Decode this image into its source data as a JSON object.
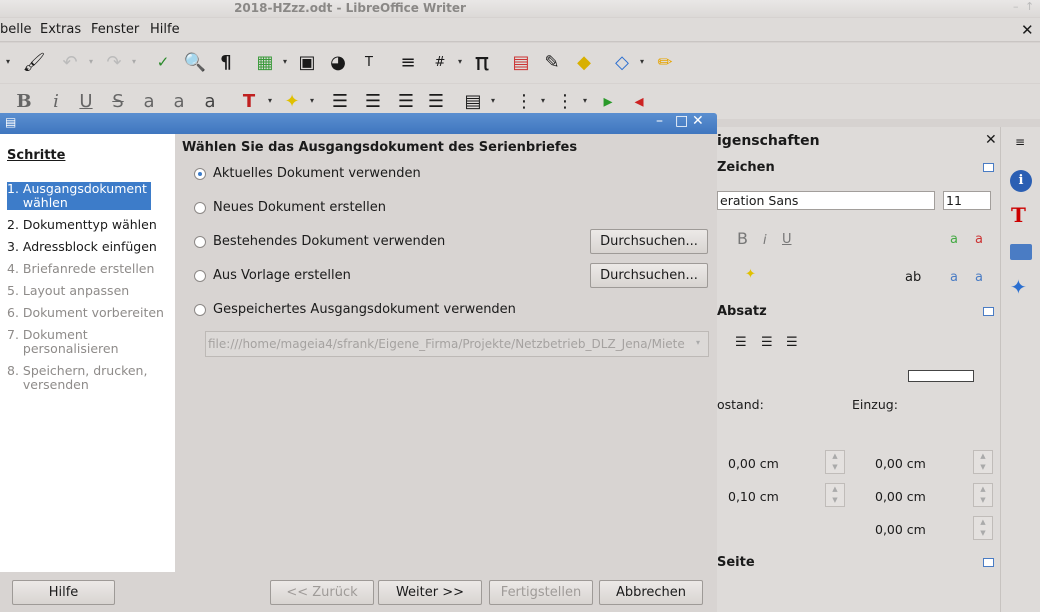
{
  "window": {
    "title": "2018-HZzz.odt - LibreOffice Writer"
  },
  "menubar": {
    "items": [
      "belle",
      "Extras",
      "Fenster",
      "Hilfe"
    ],
    "close": "✕"
  },
  "dialog": {
    "steps_heading": "Schritte",
    "steps": [
      {
        "label": "1. Ausgangsdokument\n    wählen",
        "state": "active"
      },
      {
        "label": "2. Dokumenttyp wählen",
        "state": "enabled"
      },
      {
        "label": "3. Adressblock einfügen",
        "state": "enabled"
      },
      {
        "label": "4. Briefanrede erstellen",
        "state": "disabled"
      },
      {
        "label": "5. Layout anpassen",
        "state": "disabled"
      },
      {
        "label": "6. Dokument vorbereiten",
        "state": "disabled"
      },
      {
        "label": "7. Dokument\n    personalisieren",
        "state": "disabled"
      },
      {
        "label": "8. Speichern, drucken,\n    versenden",
        "state": "disabled"
      }
    ],
    "heading": "Wählen Sie das Ausgangsdokument des Serienbriefes",
    "options": [
      {
        "label": "Aktuelles Dokument verwenden",
        "selected": true
      },
      {
        "label": "Neues Dokument erstellen",
        "selected": false
      },
      {
        "label": "Bestehendes Dokument verwenden",
        "selected": false
      },
      {
        "label": "Aus Vorlage erstellen",
        "selected": false
      },
      {
        "label": "Gespeichertes Ausgangsdokument verwenden",
        "selected": false
      }
    ],
    "browse_label": "Durchsuchen...",
    "saved_path": "file:///home/mageia4/sfrank/Eigene_Firma/Projekte/Netzbetrieb_DLZ_Jena/Miete",
    "buttons": {
      "help": "Hilfe",
      "back": "<< Zurück",
      "next": "Weiter >>",
      "finish": "Fertigstellen",
      "cancel": "Abbrechen"
    }
  },
  "sidebar": {
    "title": "igenschaften",
    "close": "✕",
    "section_zeichen": "Zeichen",
    "font_name": "eration Sans",
    "font_size": "11",
    "section_absatz": "Absatz",
    "abstand_label": "ostand:",
    "einzug_label": "Einzug:",
    "spacing_values": [
      "0,00 cm",
      "0,10 cm"
    ],
    "indent_values": [
      "0,00 cm",
      "0,00 cm",
      "0,00 cm"
    ],
    "section_seite": "Seite"
  },
  "colors": {
    "accent": "#3d7cc9",
    "dialog_title": "#4a80c8"
  }
}
